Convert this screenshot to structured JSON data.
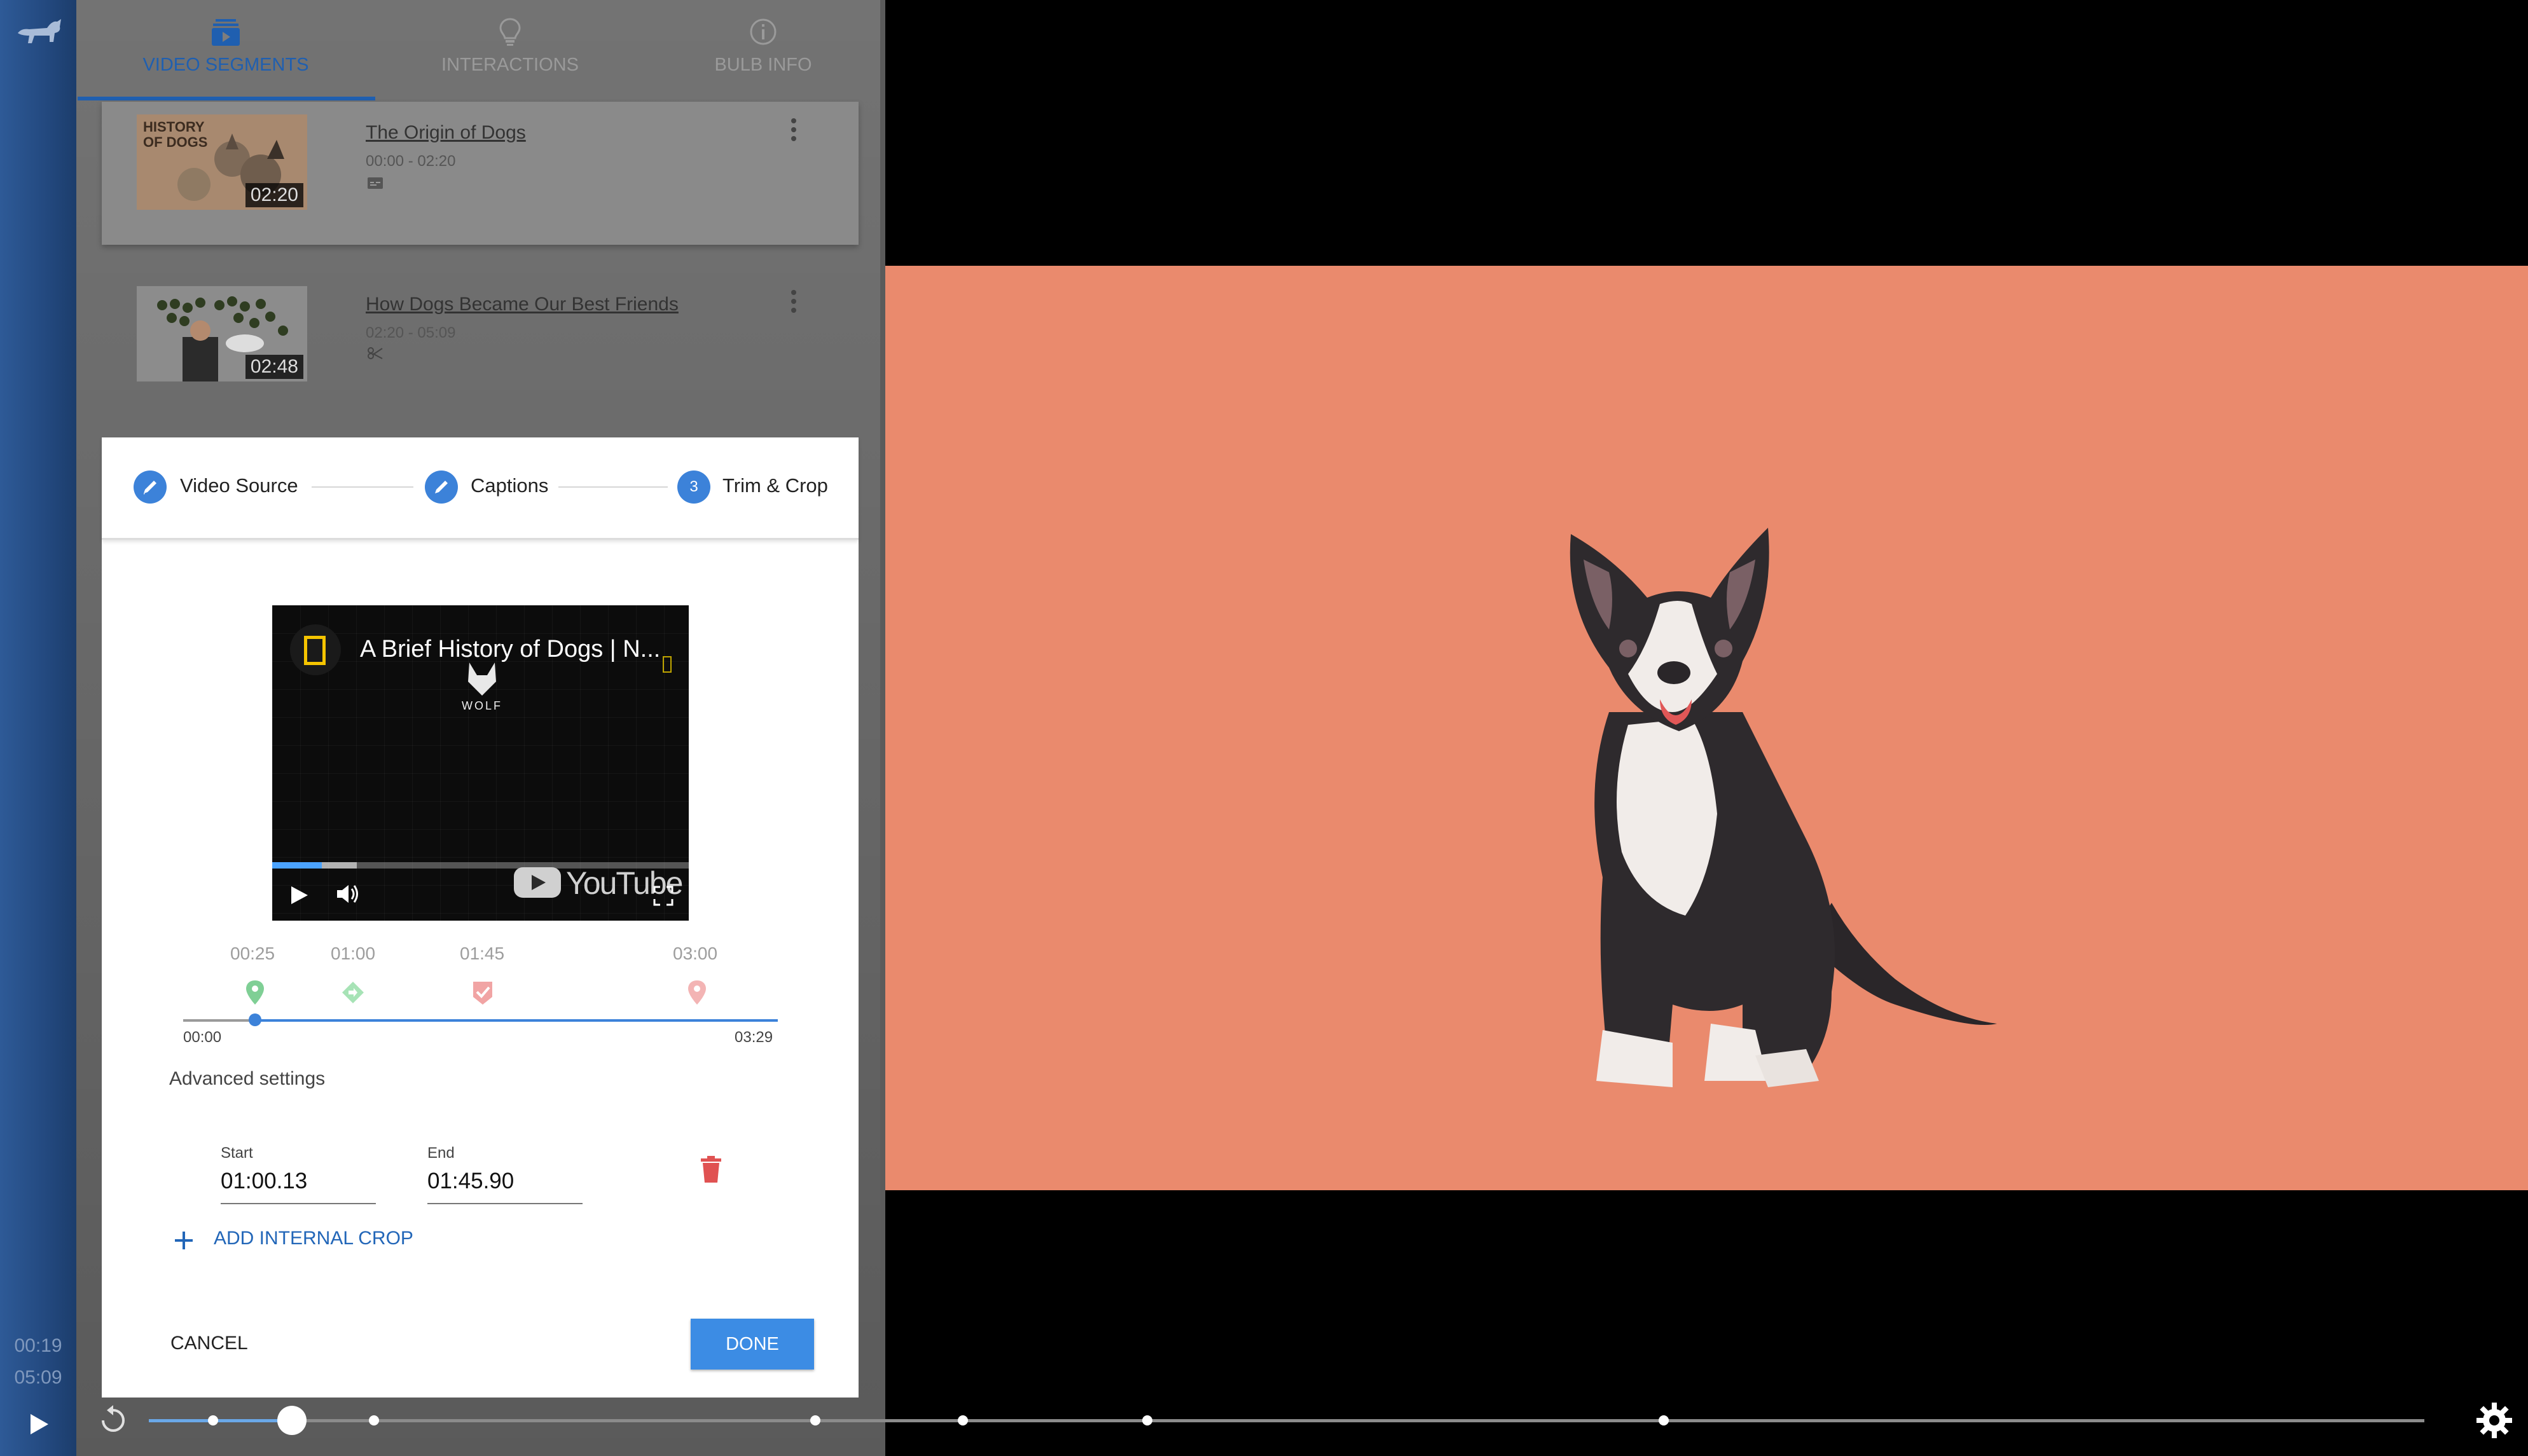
{
  "rail": {
    "current_time": "00:19",
    "total_time": "05:09"
  },
  "tabs": [
    {
      "label": "VIDEO SEGMENTS",
      "icon": "video-library-icon",
      "active": true
    },
    {
      "label": "INTERACTIONS",
      "icon": "lightbulb-icon",
      "active": false
    },
    {
      "label": "BULB INFO",
      "icon": "info-icon",
      "active": false
    }
  ],
  "segments": [
    {
      "title": "The Origin of Dogs",
      "range": "00:00 - 02:20",
      "duration": "02:20",
      "thumb_text": "HISTORY OF DOGS",
      "meta_icon": "captions-icon"
    },
    {
      "title": "How Dogs Became Our Best Friends",
      "range": "02:20 - 05:09",
      "duration": "02:48",
      "meta_icon": "scissors-icon"
    }
  ],
  "stepper": {
    "steps": [
      {
        "label": "Video Source",
        "state": "edit"
      },
      {
        "label": "Captions",
        "state": "edit"
      },
      {
        "label": "Trim & Crop",
        "number": "3",
        "state": "current"
      }
    ]
  },
  "player": {
    "title": "A Brief History of Dogs | N...",
    "watermark": "WOLF",
    "brand": "YouTube",
    "progress": 0.12
  },
  "timeline": {
    "marker_times": [
      "00:25",
      "01:00",
      "01:45",
      "03:00"
    ],
    "start": "00:00",
    "end": "03:29"
  },
  "advanced_settings_label": "Advanced settings",
  "crop": {
    "start_label": "Start",
    "start_value": "01:00.13",
    "end_label": "End",
    "end_value": "01:45.90"
  },
  "add_crop_label": "ADD INTERNAL CROP",
  "cancel_label": "CANCEL",
  "done_label": "DONE",
  "colors": {
    "accent": "#3c82d9",
    "video_bg": "#ea8a6d",
    "delete": "#e05252"
  }
}
